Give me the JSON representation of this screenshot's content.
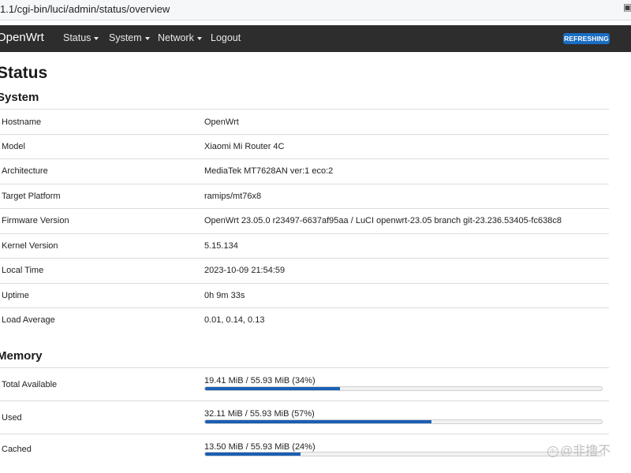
{
  "browser": {
    "url": "1.1/cgi-bin/luci/admin/status/overview"
  },
  "navbar": {
    "brand": "OpenWrt",
    "menu": [
      {
        "label": "Status",
        "dropdown": true
      },
      {
        "label": "System",
        "dropdown": true
      },
      {
        "label": "Network",
        "dropdown": true
      },
      {
        "label": "Logout",
        "dropdown": false
      }
    ],
    "refresh_badge": "REFRESHING",
    "badge_color": "#1a6ec3"
  },
  "page": {
    "title": "Status"
  },
  "system": {
    "title": "System",
    "rows": [
      {
        "label": "Hostname",
        "value": "OpenWrt"
      },
      {
        "label": "Model",
        "value": "Xiaomi Mi Router 4C"
      },
      {
        "label": "Architecture",
        "value": "MediaTek MT7628AN ver:1 eco:2"
      },
      {
        "label": "Target Platform",
        "value": "ramips/mt76x8"
      },
      {
        "label": "Firmware Version",
        "value": "OpenWrt 23.05.0 r23497-6637af95aa / LuCI openwrt-23.05 branch git-23.236.53405-fc638c8"
      },
      {
        "label": "Kernel Version",
        "value": "5.15.134"
      },
      {
        "label": "Local Time",
        "value": "2023-10-09 21:54:59"
      },
      {
        "label": "Uptime",
        "value": "0h 9m 33s"
      },
      {
        "label": "Load Average",
        "value": "0.01, 0.14, 0.13"
      }
    ]
  },
  "memory": {
    "title": "Memory",
    "bar_color": "#1a5fb4",
    "rows": [
      {
        "label": "Total Available",
        "value": "19.41 MiB / 55.93 MiB (34%)",
        "percent": 34
      },
      {
        "label": "Used",
        "value": "32.11 MiB / 55.93 MiB (57%)",
        "percent": 57
      },
      {
        "label": "Cached",
        "value": "13.50 MiB / 55.93 MiB (24%)",
        "percent": 24
      }
    ]
  },
  "watermark": {
    "logo_text": "du",
    "text": "@非撸不"
  }
}
